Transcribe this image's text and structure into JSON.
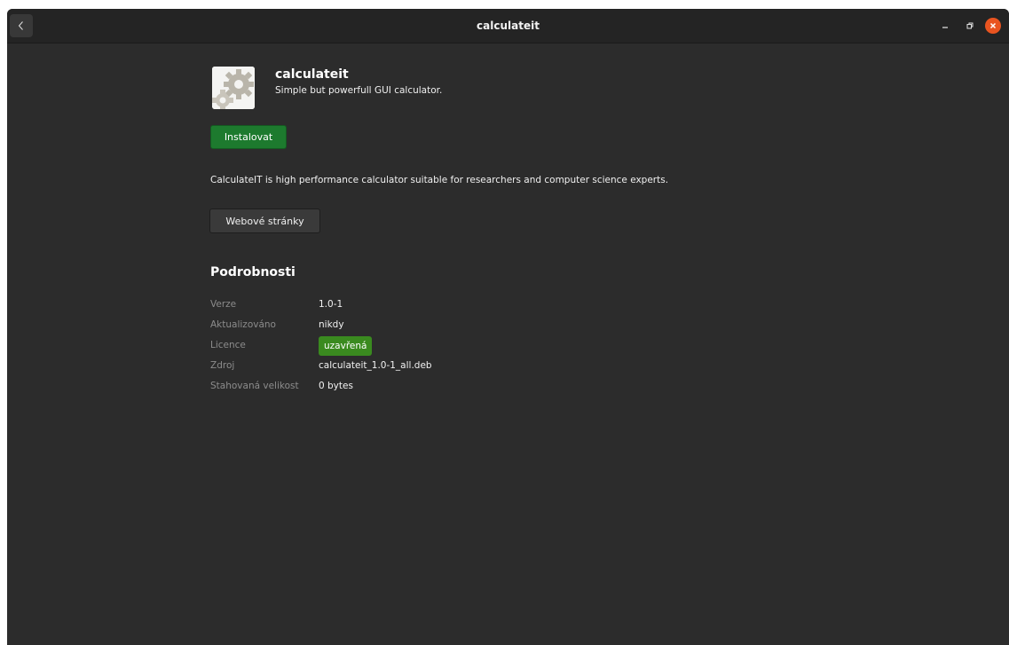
{
  "window": {
    "title": "calculateit"
  },
  "app": {
    "name": "calculateit",
    "summary": "Simple but powerfull GUI calculator.",
    "install_label": "Instalovat",
    "description": "CalculateIT is high performance calculator suitable for researchers and computer science experts.",
    "website_label": "Webové stránky",
    "icon": "gears-icon"
  },
  "details": {
    "heading": "Podrobnosti",
    "rows": [
      {
        "key": "Verze",
        "value": "1.0-1"
      },
      {
        "key": "Aktualizováno",
        "value": "nikdy"
      },
      {
        "key": "Licence",
        "value": "uzavřená"
      },
      {
        "key": "Zdroj",
        "value": "calculateit_1.0-1_all.deb"
      },
      {
        "key": "Stahovaná velikost",
        "value": "0 bytes"
      }
    ]
  },
  "colors": {
    "install_button": "#1d7a2e",
    "license_badge": "#3a8a1f",
    "close_button": "#e95420",
    "background": "#2c2c2c"
  }
}
